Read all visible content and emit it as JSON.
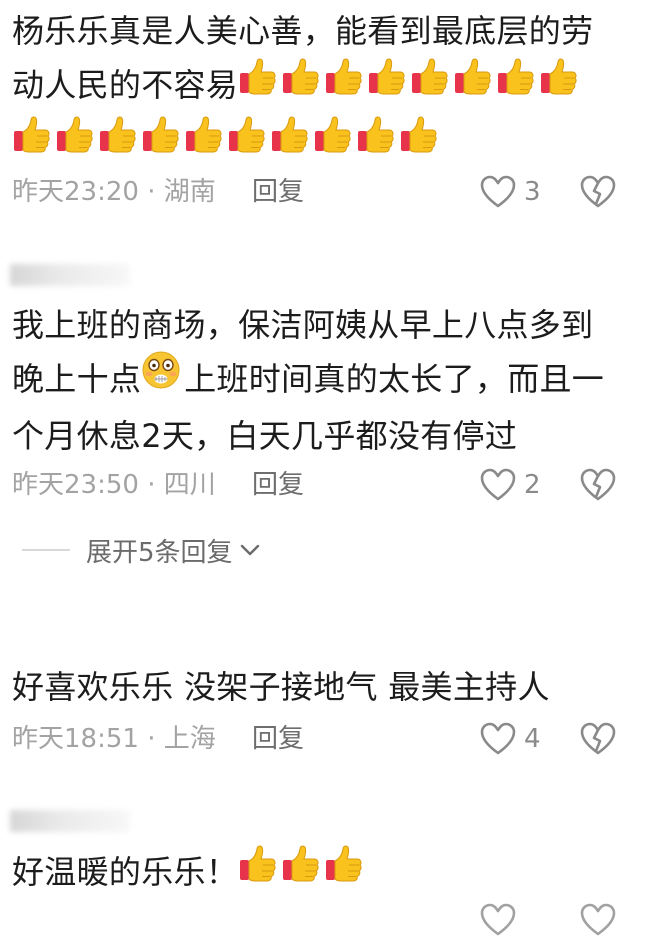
{
  "comments": [
    {
      "text_line1": "杨乐乐真是人美心善，能看到最底层的劳",
      "text_line2": "动人民的不容易",
      "time": "昨天23:20 · 湖南",
      "reply": "回复",
      "likes": "3",
      "thumbs_line2": 8,
      "thumbs_line3": 10
    },
    {
      "text_line1": "我上班的商场，保洁阿姨从早上八点多到",
      "text_line2a": "晚上十点",
      "text_line2b": "上班时间真的太长了，而且一",
      "text_line3": "个月休息2天，白天几乎都没有停过",
      "time": "昨天23:50 · 四川",
      "reply": "回复",
      "likes": "2",
      "expand_label": "展开5条回复"
    },
    {
      "text": "好喜欢乐乐 没架子接地气 最美主持人",
      "time": "昨天18:51 · 上海",
      "reply": "回复",
      "likes": "4"
    },
    {
      "text": "好温暖的乐乐！",
      "thumbs": 3
    }
  ],
  "icons": {
    "like": "heart-outline-icon",
    "dislike": "broken-heart-icon",
    "thumbs": "thumbs-up-emoji",
    "shocked": "shocked-face-emoji",
    "expand": "chevron-down-icon"
  },
  "colors": {
    "thumb_yellow": "#f9c21c",
    "cuff_red": "#e8344a",
    "meta_gray": "#a3a3a3"
  }
}
